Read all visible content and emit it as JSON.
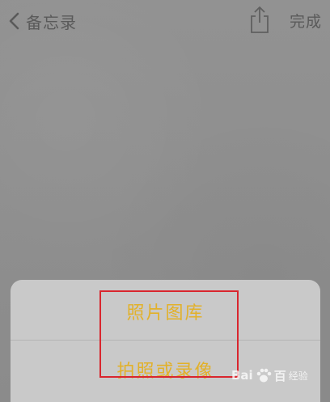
{
  "navbar": {
    "back_label": "备忘录",
    "done_label": "完成"
  },
  "action_sheet": {
    "options": [
      {
        "label": "照片图库"
      },
      {
        "label": "拍照或录像"
      }
    ],
    "text_color": "#e2b12a",
    "highlight_color": "#d9262e"
  },
  "watermark": {
    "brand_left": "Bai",
    "brand_right": "百",
    "sub": "经验",
    "icon": "paw-icon"
  }
}
